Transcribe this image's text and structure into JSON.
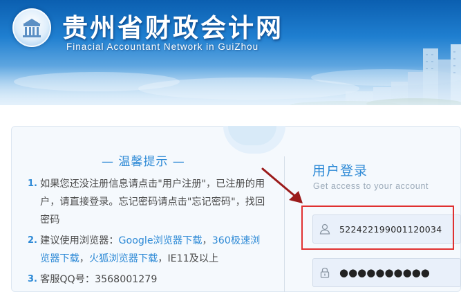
{
  "header": {
    "title": "贵州省财政会计网",
    "subtitle": "Finacial  Accountant Network in GuiZhou"
  },
  "tips": {
    "title": "— 温馨提示 —",
    "items": [
      {
        "number": "1.",
        "text": "如果您还没注册信息请点击\"用户注册\"，已注册的用户，请直接登录。忘记密码请点击\"忘记密码\"，找回密码"
      },
      {
        "number": "2.",
        "prefix": "建议使用浏览器：",
        "link_google": "Google浏览器下载",
        "sep1": "，",
        "link_360": "360极速浏览器下载",
        "sep2": "，",
        "link_firefox": "火狐浏览器下载",
        "suffix": "，IE11及以上"
      },
      {
        "number": "3.",
        "text": "客服QQ号：3568001279"
      }
    ]
  },
  "login": {
    "title": "用户登录",
    "subtitle": "Get access to your account",
    "username_value": "522422199001120034",
    "password_value": "●●●●●●●●●●"
  },
  "colors": {
    "accent": "#2e8ad6",
    "highlight": "#e03030",
    "arrow": "#9b1b1b"
  }
}
